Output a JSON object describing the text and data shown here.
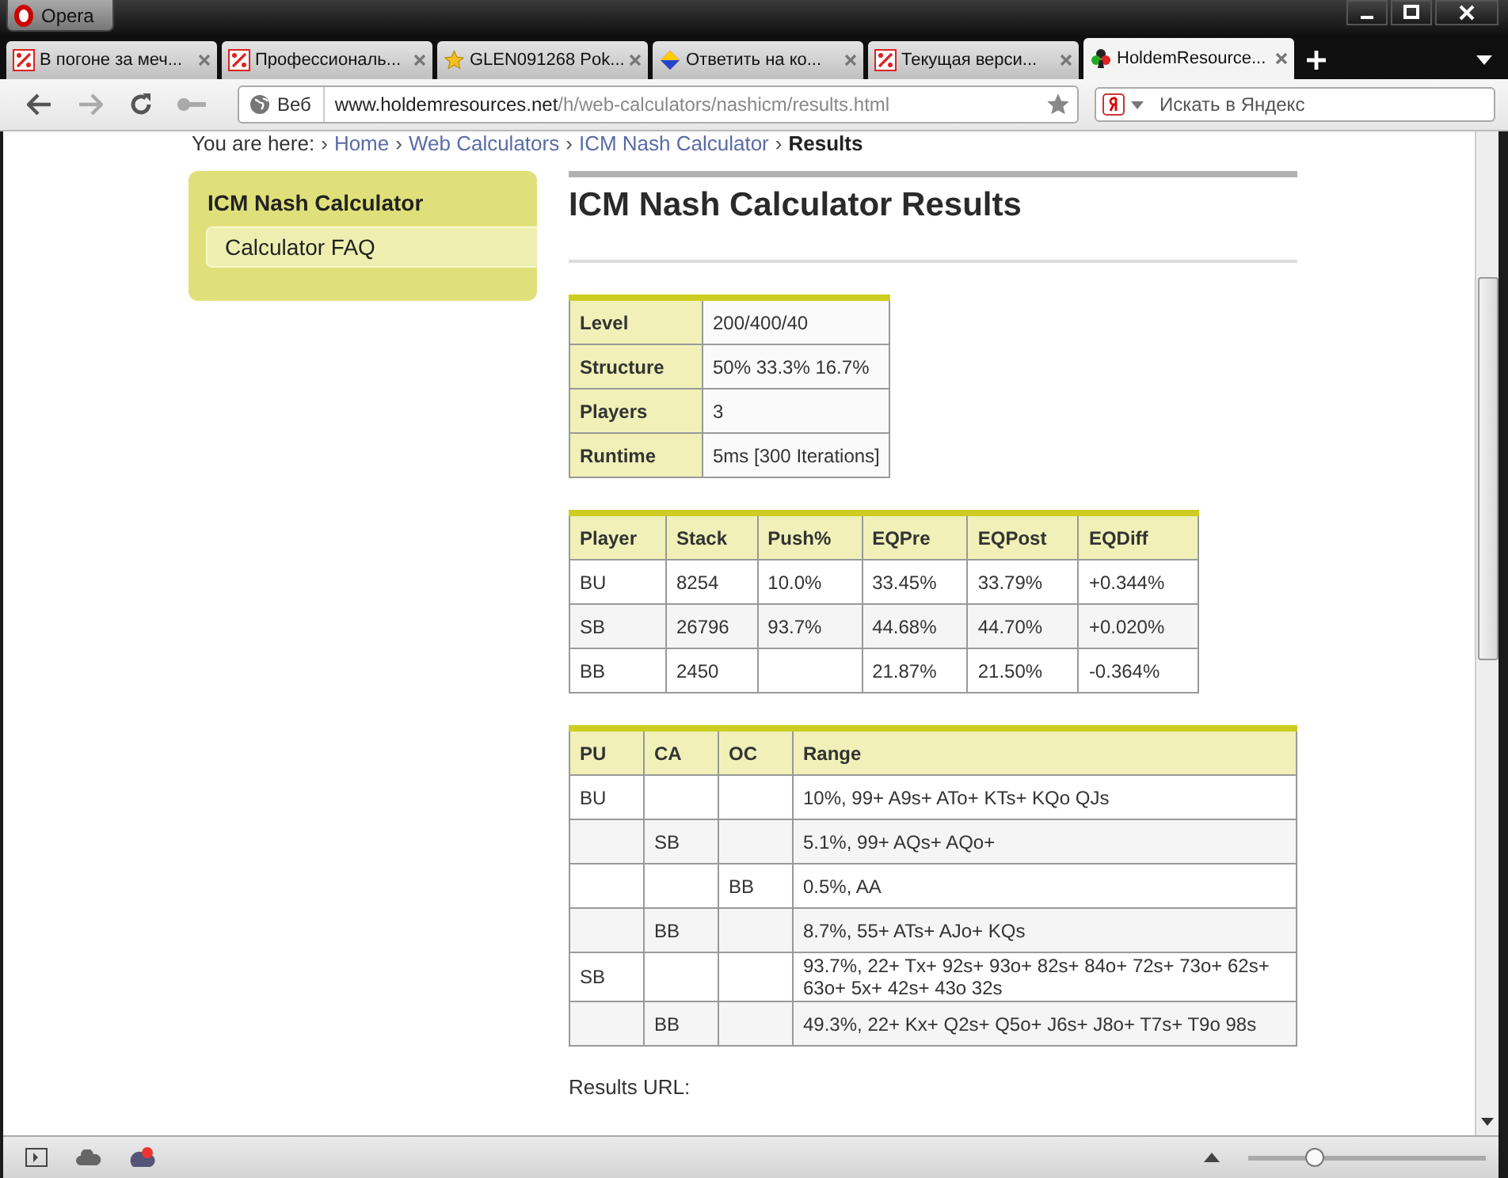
{
  "window": {
    "title": "Opera"
  },
  "tabs": [
    {
      "label": "В погоне за меч...",
      "selected": false
    },
    {
      "label": "Профессиональ...",
      "selected": false
    },
    {
      "label": "GLEN091268 Pok...",
      "selected": false
    },
    {
      "label": "Ответить на ко...",
      "selected": false
    },
    {
      "label": "Текущая верси...",
      "selected": false
    },
    {
      "label": "HoldemResource...",
      "selected": true
    }
  ],
  "address_bar": {
    "scope": "Веб",
    "url_host": "www.holdemresources.net",
    "url_path": "/h/web-calculators/nashicm/results.html"
  },
  "search": {
    "placeholder": "Искать в Яндекс"
  },
  "breadcrumb": {
    "label": "You are here:",
    "separator": "›",
    "items": [
      "Home",
      "Web Calculators",
      "ICM Nash Calculator",
      "Results"
    ]
  },
  "sidebar": {
    "title": "ICM Nash Calculator",
    "items": [
      "Calculator FAQ"
    ]
  },
  "page_title": "ICM Nash Calculator Results",
  "summary": [
    {
      "label": "Level",
      "value": "200/400/40"
    },
    {
      "label": "Structure",
      "value": "50% 33.3% 16.7%"
    },
    {
      "label": "Players",
      "value": "3"
    },
    {
      "label": "Runtime",
      "value": "5ms [300 Iterations]"
    }
  ],
  "players_table": {
    "columns": [
      "Player",
      "Stack",
      "Push%",
      "EQPre",
      "EQPost",
      "EQDiff"
    ],
    "rows": [
      [
        "BU",
        "8254",
        "10.0%",
        "33.45%",
        "33.79%",
        "+0.344%"
      ],
      [
        "SB",
        "26796",
        "93.7%",
        "44.68%",
        "44.70%",
        "+0.020%"
      ],
      [
        "BB",
        "2450",
        "",
        "21.87%",
        "21.50%",
        "-0.364%"
      ]
    ]
  },
  "range_table": {
    "columns": [
      "PU",
      "CA",
      "OC",
      "Range"
    ],
    "rows": [
      [
        "BU",
        "",
        "",
        "10%, 99+ A9s+ ATo+ KTs+ KQo QJs"
      ],
      [
        "",
        "SB",
        "",
        "5.1%, 99+ AQs+ AQo+"
      ],
      [
        "",
        "",
        "BB",
        "0.5%, AA"
      ],
      [
        "",
        "BB",
        "",
        "8.7%, 55+ ATs+ AJo+ KQs"
      ],
      [
        "SB",
        "",
        "",
        "93.7%, 22+ Tx+ 92s+ 93o+ 82s+ 84o+ 72s+ 73o+ 62s+ 63o+ 5x+ 42s+ 43o 32s"
      ],
      [
        "",
        "BB",
        "",
        "49.3%, 22+ Kx+ Q2s+ Q5o+ J6s+ J8o+ T7s+ T9o 98s"
      ]
    ]
  },
  "results_url_label": "Results URL:",
  "zoom": {
    "level": 0.28
  }
}
